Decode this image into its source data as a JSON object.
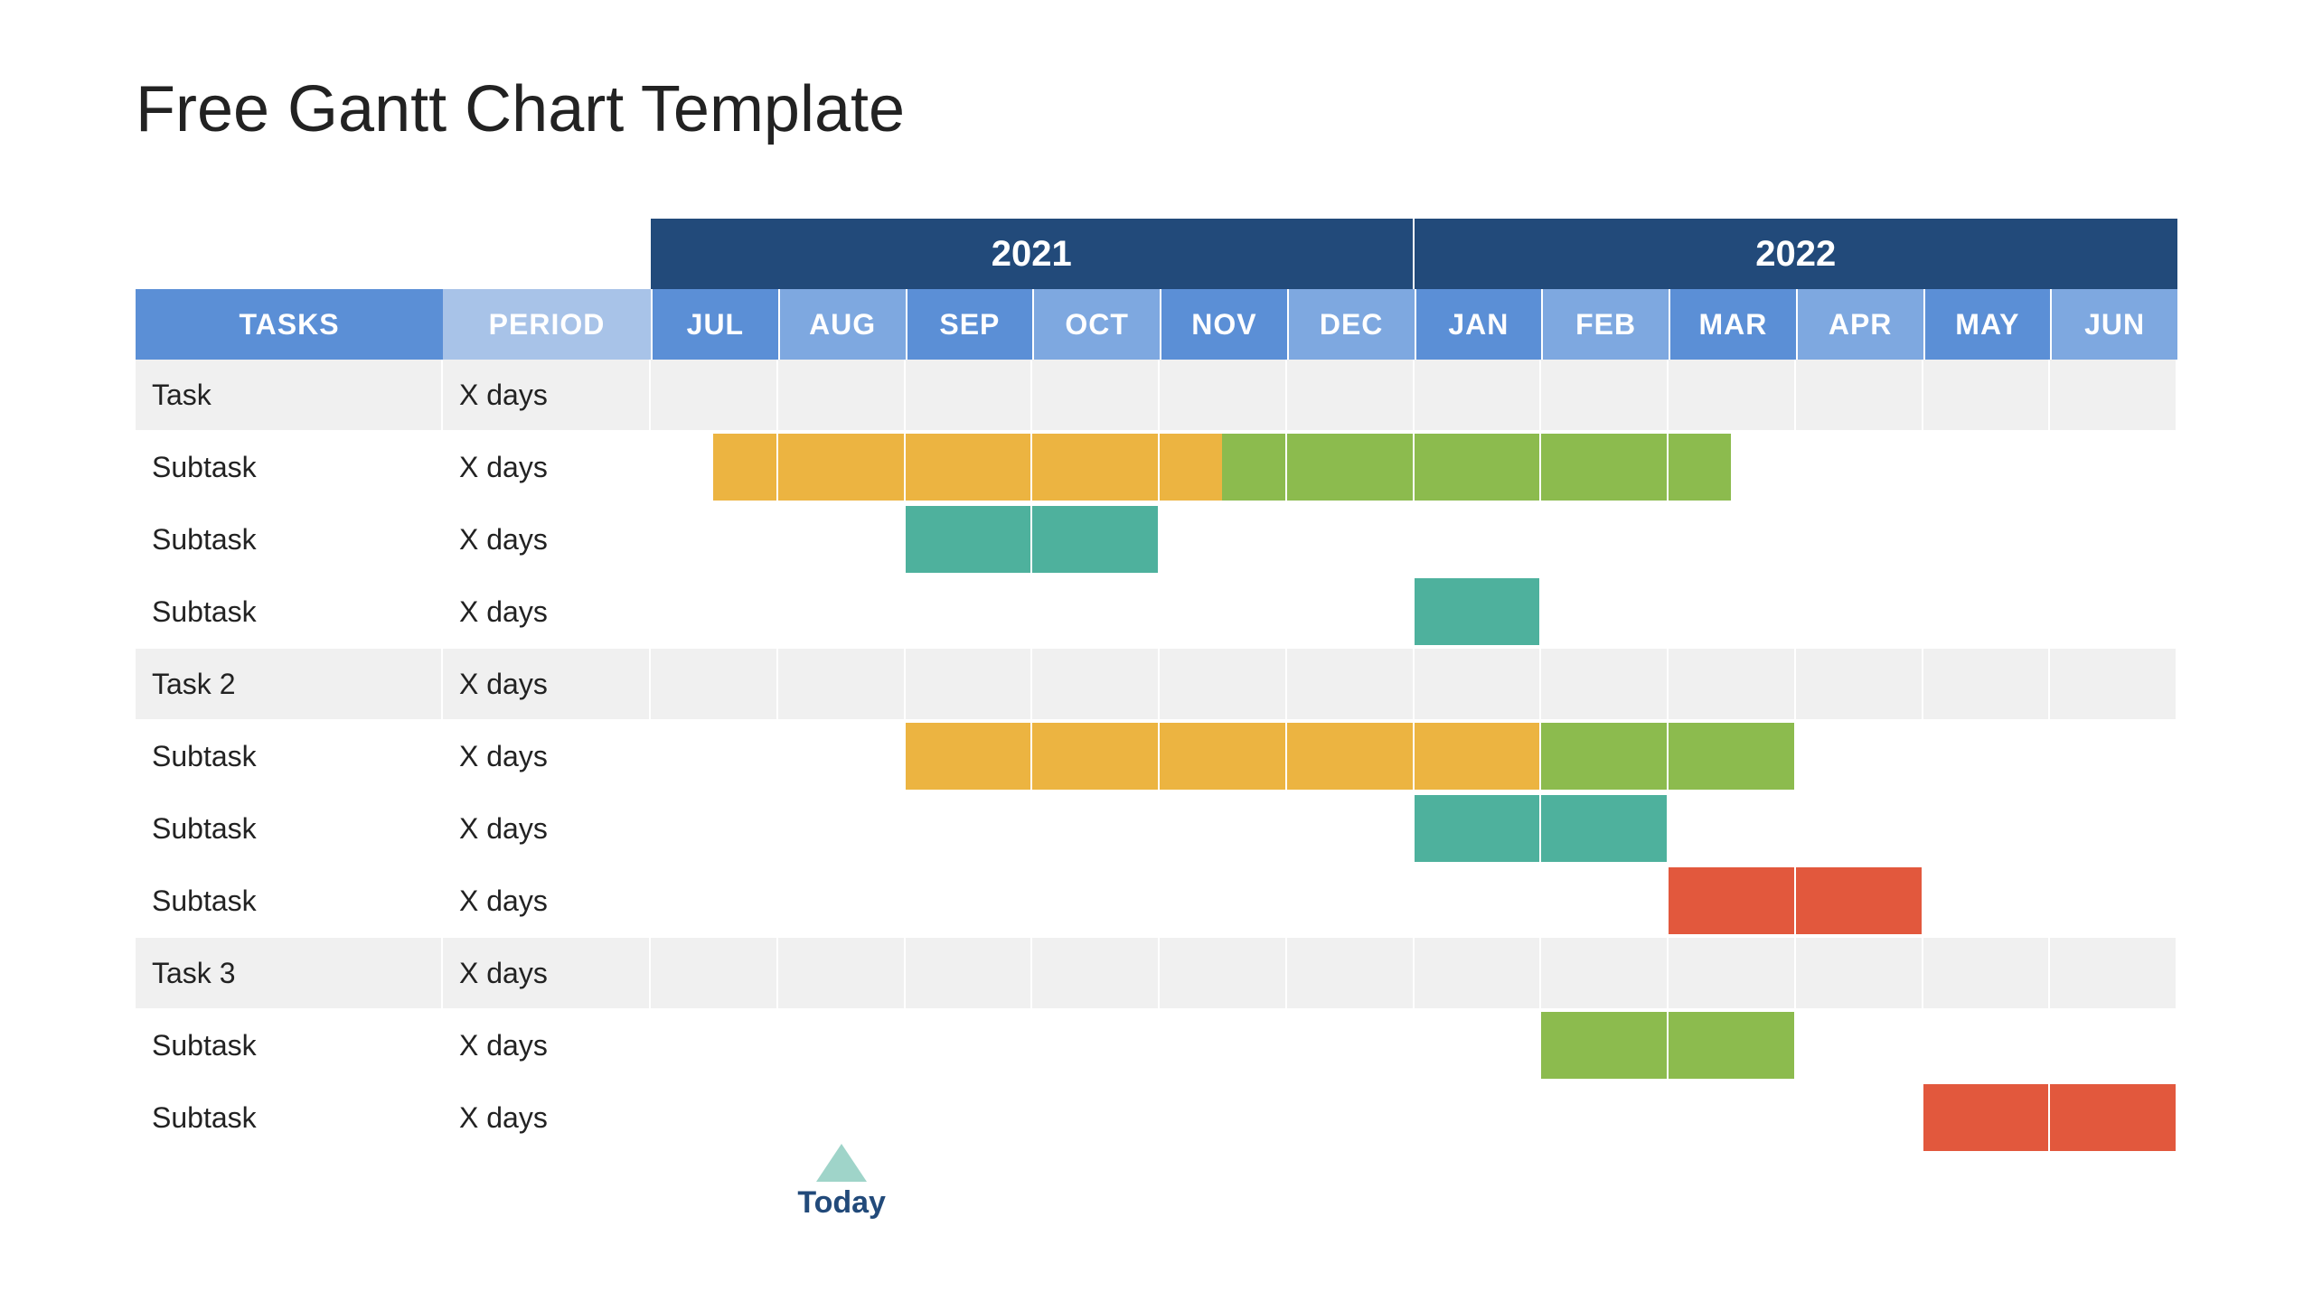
{
  "title": "Free Gantt Chart Template",
  "headers": {
    "tasks": "TASKS",
    "period": "PERIOD",
    "year1": "2021",
    "year2": "2022",
    "months": [
      "JUL",
      "AUG",
      "SEP",
      "OCT",
      "NOV",
      "DEC",
      "JAN",
      "FEB",
      "MAR",
      "APR",
      "MAY",
      "JUN"
    ]
  },
  "today": {
    "label": "Today",
    "month_index": 1.5
  },
  "rows": [
    {
      "name": "Task",
      "period": "X days",
      "is_task": true
    },
    {
      "name": "Subtask",
      "period": "X days",
      "is_task": false
    },
    {
      "name": "Subtask",
      "period": "X days",
      "is_task": false
    },
    {
      "name": "Subtask",
      "period": "X days",
      "is_task": false
    },
    {
      "name": "Task 2",
      "period": "X days",
      "is_task": true
    },
    {
      "name": "Subtask",
      "period": "X days",
      "is_task": false
    },
    {
      "name": "Subtask",
      "period": "X days",
      "is_task": false
    },
    {
      "name": "Subtask",
      "period": "X days",
      "is_task": false
    },
    {
      "name": "Task 3",
      "period": "X days",
      "is_task": true
    },
    {
      "name": "Subtask",
      "period": "X days",
      "is_task": false
    },
    {
      "name": "Subtask",
      "period": "X days",
      "is_task": false
    }
  ],
  "chart_data": {
    "type": "gantt",
    "title": "Free Gantt Chart Template",
    "timeline": {
      "years": [
        "2021",
        "2022"
      ],
      "months": [
        "JUL",
        "AUG",
        "SEP",
        "OCT",
        "NOV",
        "DEC",
        "JAN",
        "FEB",
        "MAR",
        "APR",
        "MAY",
        "JUN"
      ]
    },
    "today_marker": {
      "position": "mid AUG 2021",
      "label": "Today"
    },
    "legend_colors": {
      "amber": "#ecb441",
      "green": "#8cbb4e",
      "teal": "#4eb19d",
      "red": "#e2583d"
    },
    "tasks": [
      {
        "row": 0,
        "name": "Task",
        "period": "X days",
        "bars": []
      },
      {
        "row": 1,
        "name": "Subtask",
        "period": "X days",
        "bars": [
          {
            "start": 0.5,
            "end": 4.5,
            "color": "amber"
          },
          {
            "start": 4.5,
            "end": 8.5,
            "color": "green"
          }
        ]
      },
      {
        "row": 2,
        "name": "Subtask",
        "period": "X days",
        "bars": [
          {
            "start": 2,
            "end": 4,
            "color": "teal"
          }
        ]
      },
      {
        "row": 3,
        "name": "Subtask",
        "period": "X days",
        "bars": [
          {
            "start": 6,
            "end": 7,
            "color": "teal"
          }
        ]
      },
      {
        "row": 4,
        "name": "Task 2",
        "period": "X days",
        "bars": []
      },
      {
        "row": 5,
        "name": "Subtask",
        "period": "X days",
        "bars": [
          {
            "start": 2,
            "end": 7,
            "color": "amber"
          },
          {
            "start": 7,
            "end": 9,
            "color": "green"
          }
        ]
      },
      {
        "row": 6,
        "name": "Subtask",
        "period": "X days",
        "bars": [
          {
            "start": 6,
            "end": 8,
            "color": "teal"
          }
        ]
      },
      {
        "row": 7,
        "name": "Subtask",
        "period": "X days",
        "bars": [
          {
            "start": 8,
            "end": 10,
            "color": "red"
          }
        ]
      },
      {
        "row": 8,
        "name": "Task 3",
        "period": "X days",
        "bars": []
      },
      {
        "row": 9,
        "name": "Subtask",
        "period": "X days",
        "bars": [
          {
            "start": 7,
            "end": 9,
            "color": "green"
          }
        ]
      },
      {
        "row": 10,
        "name": "Subtask",
        "period": "X days",
        "bars": [
          {
            "start": 10,
            "end": 12,
            "color": "red"
          }
        ]
      }
    ]
  }
}
